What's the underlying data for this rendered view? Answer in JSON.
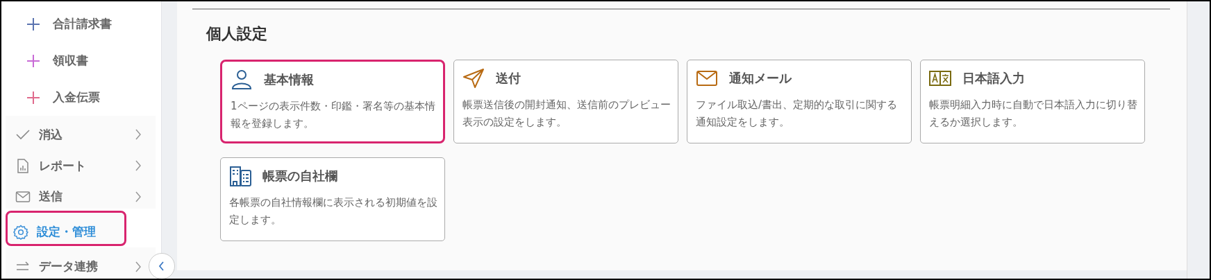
{
  "sidebar": {
    "items": [
      {
        "kind": "sub",
        "label": "合計請求書",
        "color": "#5b74b0",
        "selected": false
      },
      {
        "kind": "sub",
        "label": "領収書",
        "color": "#c86ad6",
        "selected": false
      },
      {
        "kind": "sub",
        "label": "入金伝票",
        "color": "#e06a8c",
        "selected": false
      },
      {
        "kind": "main",
        "label": "消込",
        "selected": false
      },
      {
        "kind": "main",
        "label": "レポート",
        "selected": false
      },
      {
        "kind": "main",
        "label": "送信",
        "selected": false
      },
      {
        "kind": "main",
        "label": "設定・管理",
        "selected": true
      },
      {
        "kind": "main",
        "label": "データ連携",
        "selected": false
      }
    ]
  },
  "section": {
    "title": "個人設定",
    "cards": [
      {
        "title": "基本情報",
        "description": "1ページの表示件数・印鑑・署名等の基本情報を登録します。",
        "selected": true
      },
      {
        "title": "送付",
        "description": "帳票送信後の開封通知、送信前のプレビュー表示の設定をします。",
        "selected": false
      },
      {
        "title": "通知メール",
        "description": "ファイル取込/書出、定期的な取引に関する通知設定をします。",
        "selected": false
      },
      {
        "title": "日本語入力",
        "description": "帳票明細入力時に自動で日本語入力に切り替えるか選択します。",
        "selected": false
      },
      {
        "title": "帳票の自社欄",
        "description": "各帳票の自社情報欄に表示される初期値を設定します。",
        "selected": false
      }
    ]
  }
}
